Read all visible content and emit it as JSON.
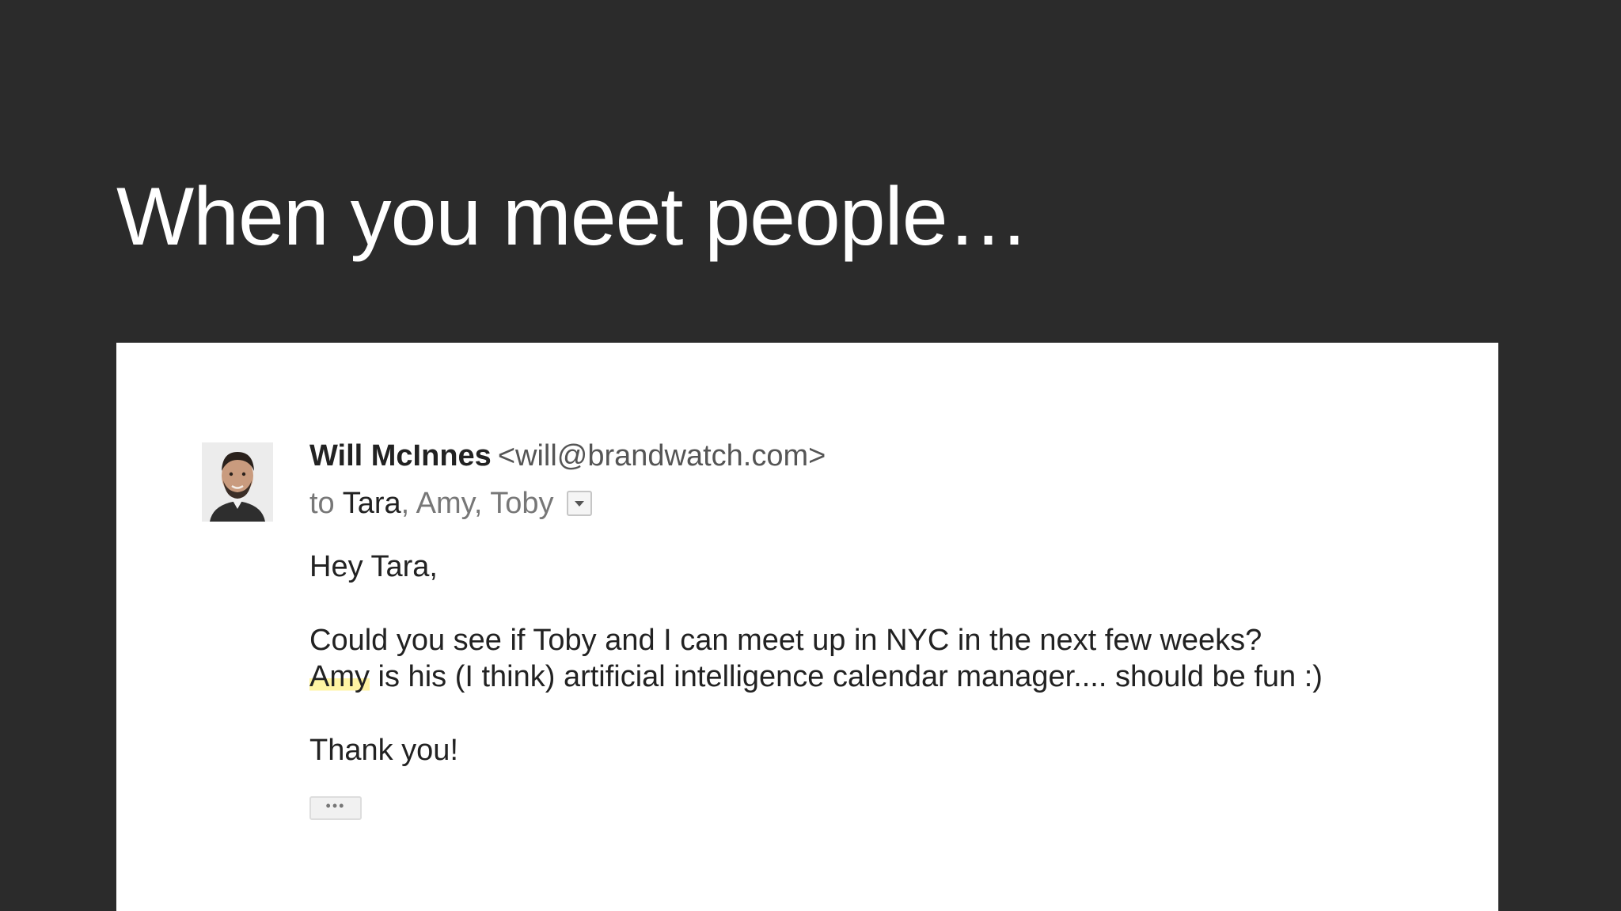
{
  "slide": {
    "title": "When you meet people…",
    "background_color": "#2b2b2b"
  },
  "email": {
    "avatar_icon": "person-photo-avatar",
    "sender": {
      "name": "Will McInnes",
      "email": "<will@brandwatch.com>"
    },
    "recipients": {
      "to_label": "to",
      "first": "Tara",
      "rest": ", Amy, Toby",
      "dropdown_icon": "chevron-down-icon"
    },
    "body": {
      "greeting": "Hey Tara,",
      "line1": "Could you see if Toby and I can meet up in NYC in the next few weeks?",
      "line2_highlight": "Amy",
      "line2_rest": " is his (I think) artificial intelligence calendar manager.... should be fun :)",
      "signoff": "Thank you!"
    },
    "trimmed_content_label": "•••",
    "highlight_color": "#fff4a3"
  }
}
